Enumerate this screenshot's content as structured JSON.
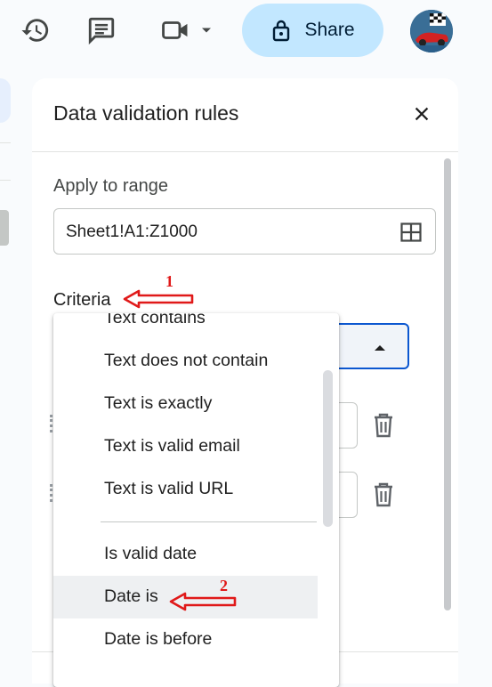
{
  "toolbar": {
    "icons": [
      "history-icon",
      "comment-icon",
      "video-call-icon",
      "chevron-down-icon"
    ],
    "share_label": "Share",
    "colors": {
      "share_bg": "#c2e7ff",
      "accent": "#0b57d0"
    }
  },
  "panel": {
    "title": "Data validation rules",
    "apply_label": "Apply to range",
    "range_value": "Sheet1!A1:Z1000",
    "criteria_label": "Criteria"
  },
  "menu": {
    "items": [
      {
        "label": "Text contains"
      },
      {
        "label": "Text does not contain"
      },
      {
        "label": "Text is exactly"
      },
      {
        "label": "Text is valid email"
      },
      {
        "label": "Text is valid URL"
      },
      {
        "label": "Is valid date"
      },
      {
        "label": "Date is"
      },
      {
        "label": "Date is before"
      }
    ],
    "highlighted": "Date is"
  },
  "annotations": {
    "a1": "1",
    "a2": "2",
    "color": "#e01919"
  }
}
